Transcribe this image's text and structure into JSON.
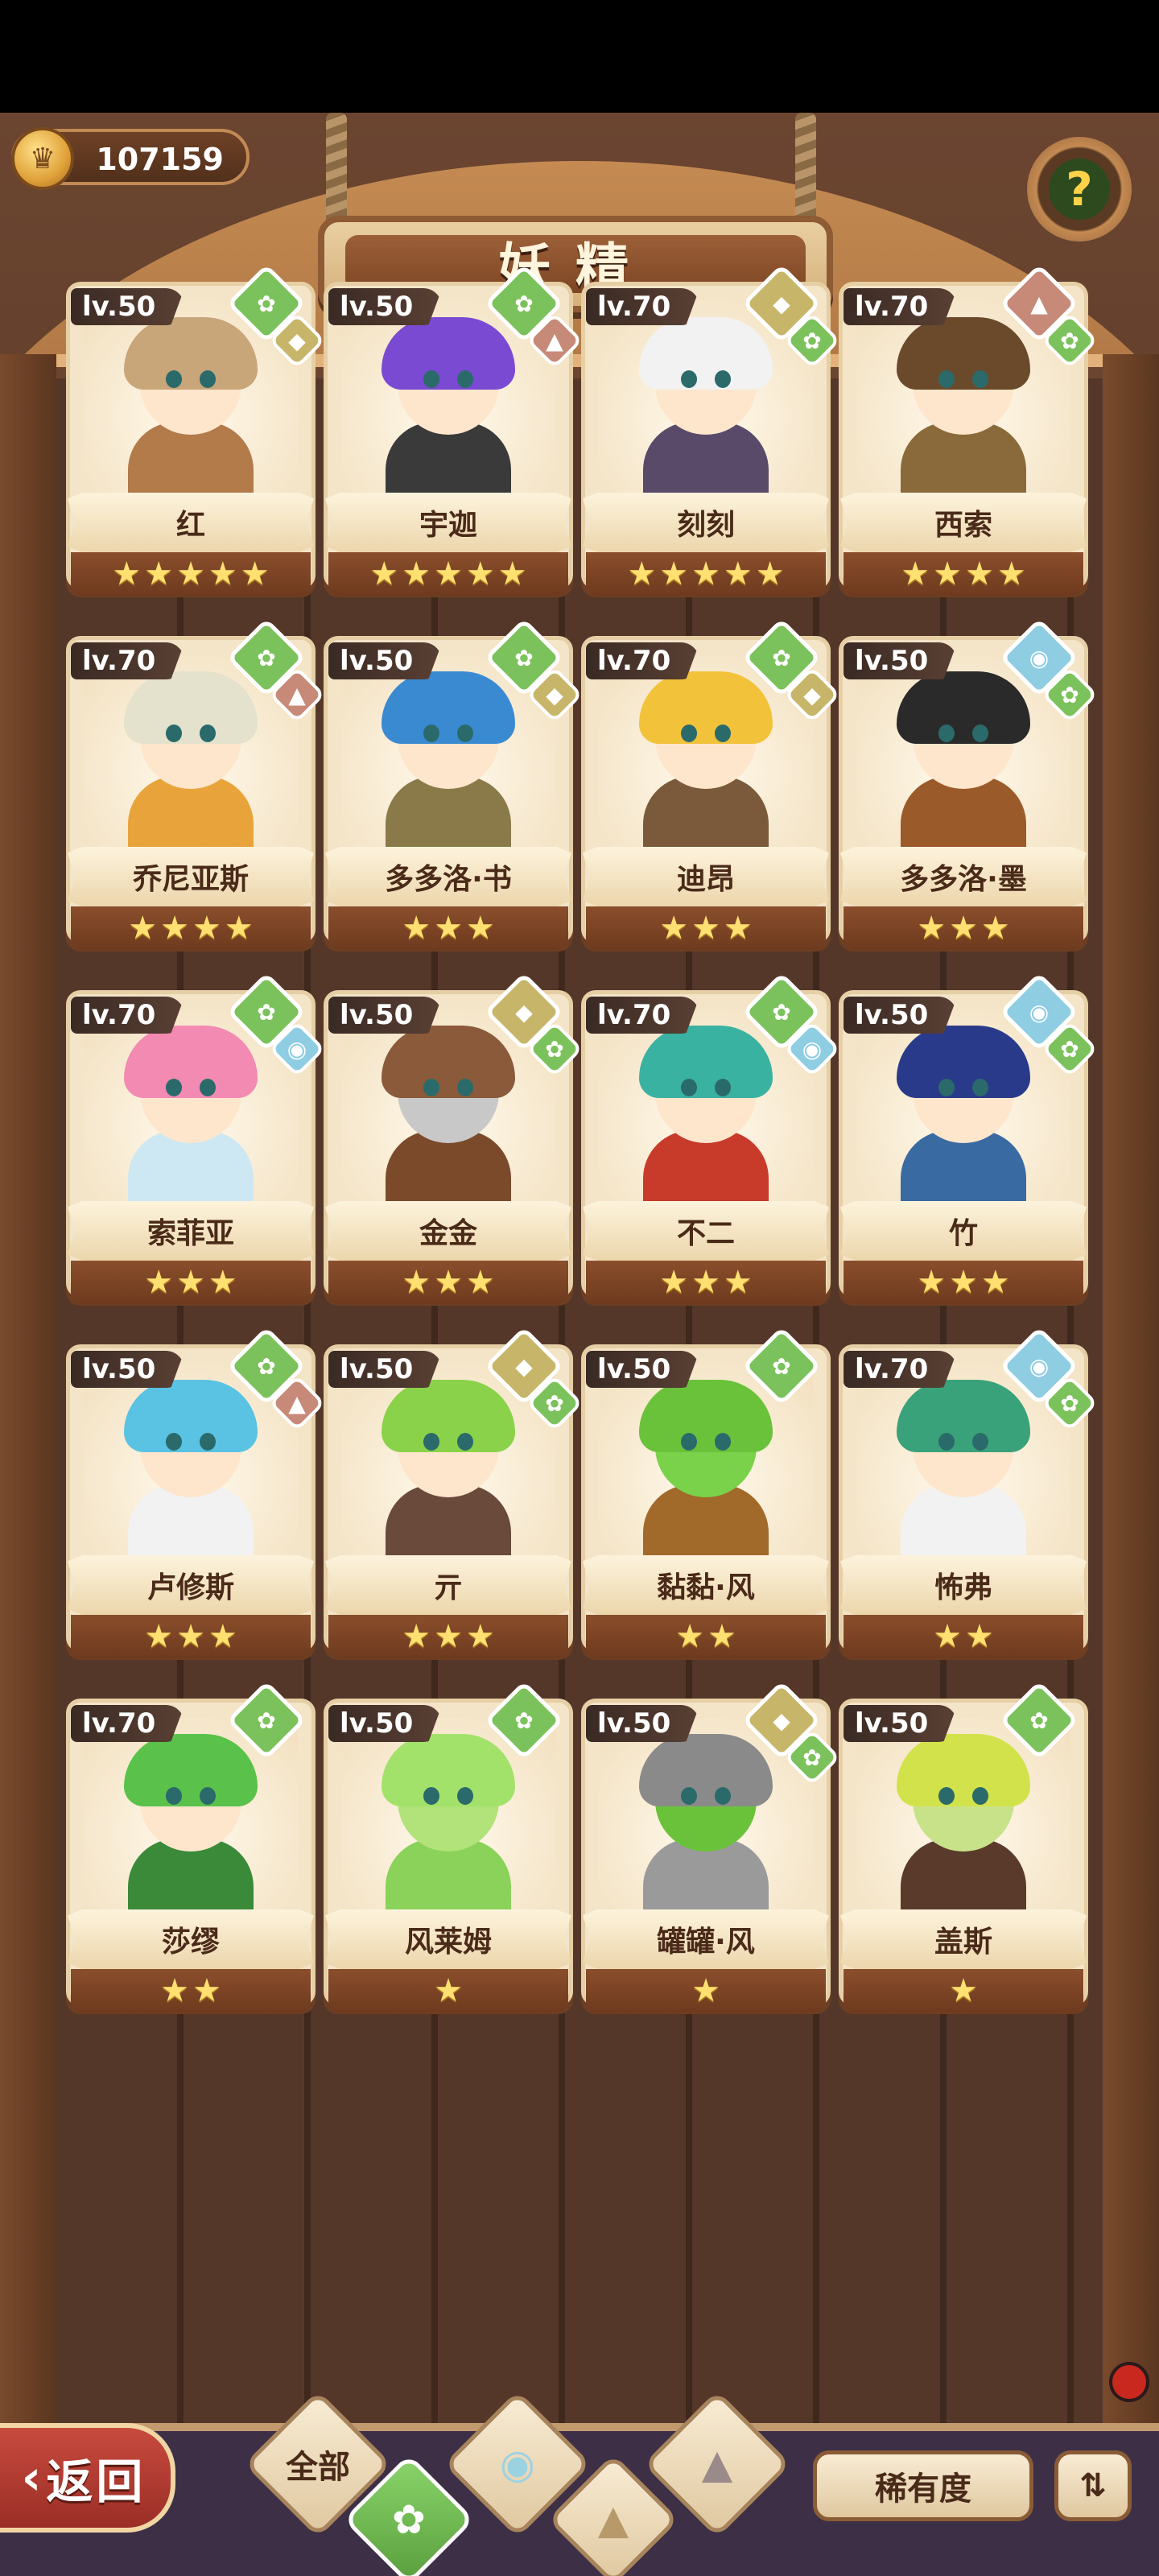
{
  "header": {
    "title": "妖精",
    "coins": "107159"
  },
  "help": {
    "label": "?"
  },
  "cards": [
    {
      "lv": "lv.50",
      "name": "红",
      "stars": 5,
      "elem": "wind",
      "sub": "earth",
      "hair": "#c9a57a",
      "skin": "#fde6cc",
      "outfit": "#b37a4a"
    },
    {
      "lv": "lv.50",
      "name": "宇迦",
      "stars": 5,
      "elem": "wind",
      "sub": "fire",
      "hair": "#7a4ad2",
      "skin": "#fde6cc",
      "outfit": "#3a3a3a"
    },
    {
      "lv": "lv.70",
      "name": "刻刻",
      "stars": 5,
      "elem": "earth",
      "sub": "wind",
      "hair": "#f2f2f2",
      "skin": "#fde6cc",
      "outfit": "#5a4a6a"
    },
    {
      "lv": "lv.70",
      "name": "西索",
      "stars": 4,
      "elem": "fire",
      "sub": "wind",
      "hair": "#6a4a2a",
      "skin": "#fde6cc",
      "outfit": "#8a6a3a"
    },
    {
      "lv": "lv.70",
      "name": "乔尼亚斯",
      "stars": 4,
      "elem": "wind",
      "sub": "fire",
      "hair": "#e4e2cc",
      "skin": "#fde6cc",
      "outfit": "#e8a43a"
    },
    {
      "lv": "lv.50",
      "name": "多多洛·书",
      "stars": 3,
      "elem": "wind",
      "sub": "earth",
      "hair": "#3a8ad2",
      "skin": "#fde6cc",
      "outfit": "#8a7a4a"
    },
    {
      "lv": "lv.70",
      "name": "迪昂",
      "stars": 3,
      "elem": "wind",
      "sub": "earth",
      "hair": "#f2c23a",
      "skin": "#fde6cc",
      "outfit": "#7a5a3a"
    },
    {
      "lv": "lv.50",
      "name": "多多洛·墨",
      "stars": 3,
      "elem": "water",
      "sub": "wind",
      "hair": "#2a2a2a",
      "skin": "#fde6cc",
      "outfit": "#9a5a2a"
    },
    {
      "lv": "lv.70",
      "name": "索菲亚",
      "stars": 3,
      "elem": "wind",
      "sub": "water",
      "hair": "#f28ab2",
      "skin": "#fde6cc",
      "outfit": "#cde8f2"
    },
    {
      "lv": "lv.50",
      "name": "金金",
      "stars": 3,
      "elem": "earth",
      "sub": "wind",
      "hair": "#8a5a3a",
      "skin": "#c8c8c8",
      "outfit": "#7a4a2a"
    },
    {
      "lv": "lv.70",
      "name": "不二",
      "stars": 3,
      "elem": "wind",
      "sub": "water",
      "hair": "#3ab2a2",
      "skin": "#fde6cc",
      "outfit": "#c83a2a"
    },
    {
      "lv": "lv.50",
      "name": "竹",
      "stars": 3,
      "elem": "water",
      "sub": "wind",
      "hair": "#2a3a8a",
      "skin": "#fde6cc",
      "outfit": "#3a6aa2"
    },
    {
      "lv": "lv.50",
      "name": "卢修斯",
      "stars": 3,
      "elem": "wind",
      "sub": "fire",
      "hair": "#5ac2e2",
      "skin": "#fde6cc",
      "outfit": "#f2f2f2"
    },
    {
      "lv": "lv.50",
      "name": "亓",
      "stars": 3,
      "elem": "earth",
      "sub": "wind",
      "hair": "#8ad24a",
      "skin": "#fde6cc",
      "outfit": "#6a4a3a"
    },
    {
      "lv": "lv.50",
      "name": "黏黏·风",
      "stars": 2,
      "elem": "wind",
      "sub": "",
      "hair": "#6ac23a",
      "skin": "#7ad24a",
      "outfit": "#a26a2a"
    },
    {
      "lv": "lv.70",
      "name": "怖弗",
      "stars": 2,
      "elem": "water",
      "sub": "wind",
      "hair": "#3aa27a",
      "skin": "#fde6cc",
      "outfit": "#f2f2f2"
    },
    {
      "lv": "lv.70",
      "name": "莎缪",
      "stars": 2,
      "elem": "wind",
      "sub": "",
      "hair": "#5ac24a",
      "skin": "#fde6cc",
      "outfit": "#3a8a3a"
    },
    {
      "lv": "lv.50",
      "name": "风莱姆",
      "stars": 1,
      "elem": "wind",
      "sub": "",
      "hair": "#a2e26a",
      "skin": "#b2e27a",
      "outfit": "#8ad25a"
    },
    {
      "lv": "lv.50",
      "name": "罐罐·风",
      "stars": 1,
      "elem": "earth",
      "sub": "wind",
      "hair": "#8a8a8a",
      "skin": "#6ac23a",
      "outfit": "#9a9a9a"
    },
    {
      "lv": "lv.50",
      "name": "盖斯",
      "stars": 1,
      "elem": "wind",
      "sub": "",
      "hair": "#d2e24a",
      "skin": "#c8e28a",
      "outfit": "#5a3a2a"
    }
  ],
  "elem_icons": {
    "wind": "✿",
    "earth": "◆",
    "fire": "▲",
    "water": "◉"
  },
  "bottom": {
    "back_arrow": "‹",
    "back_label": "返回",
    "filter_all": "全部",
    "filter_wind_icon": "✿",
    "filter_water_icon": "◉",
    "filter_earth_icon": "▲",
    "filter_fire_icon": "▲",
    "sort_label": "稀有度",
    "order_icon": "⇅"
  }
}
